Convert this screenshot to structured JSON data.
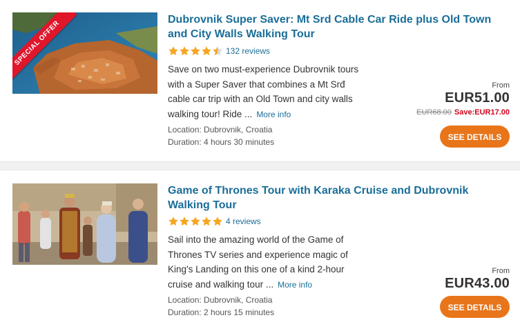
{
  "colors": {
    "title": "#1a6e98",
    "star": "#f5a623",
    "button": "#e8751a",
    "save": "#d0021b",
    "ribbon": "#e0162b"
  },
  "tours": [
    {
      "badge": "SPECIAL OFFER",
      "title": "Dubrovnik Super Saver: Mt Srd Cable Car Ride plus Old Town and City Walls Walking Tour",
      "rating": 4.5,
      "reviews": "132 reviews",
      "description": "Save on two must-experience Dubrovnik tours with a Super Saver that combines a Mt Srđ cable car trip with an Old Town and city walls walking tour! Ride ...",
      "more_info": "More info",
      "location": "Location: Dubrovnik, Croatia",
      "duration": "Duration: 4 hours 30 minutes",
      "from": "From",
      "price": "EUR51.00",
      "old_price": "EUR68.00",
      "save": "Save:EUR17.00",
      "button": "SEE DETAILS"
    },
    {
      "title": "Game of Thrones Tour with Karaka Cruise and Dubrovnik Walking Tour",
      "rating": 5,
      "reviews": "4 reviews",
      "description": "Sail into the amazing world of the Game of Thrones TV series and experience magic of King's Landing on this one of a kind 2-hour cruise and walking tour ...",
      "more_info": "More info",
      "location": "Location: Dubrovnik, Croatia",
      "duration": "Duration: 2 hours 15 minutes",
      "from": "From",
      "price": "EUR43.00",
      "button": "SEE DETAILS"
    }
  ]
}
